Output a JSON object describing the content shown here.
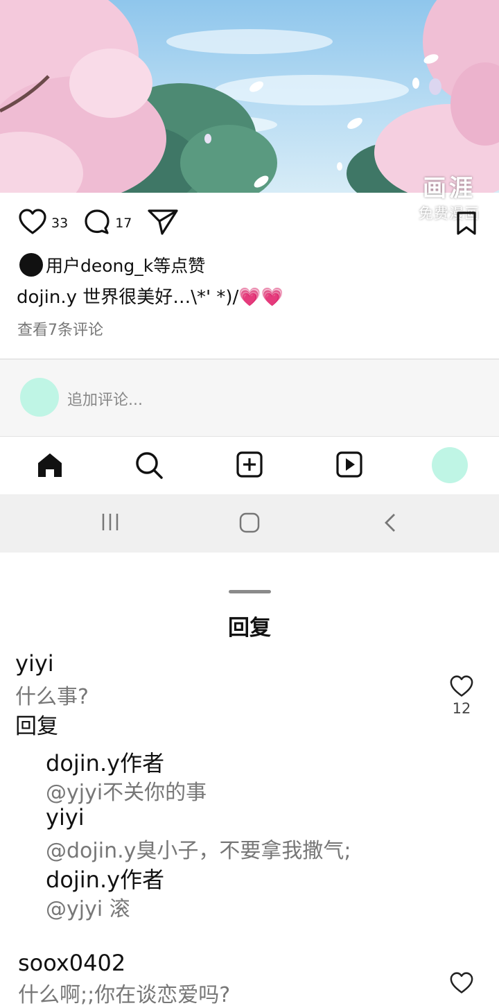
{
  "post": {
    "likes": "33",
    "comments": "17",
    "liked_by": "用户deong_k等点赞",
    "caption": "dojin.y 世界很美好…\\*' *)/",
    "caption_hearts": "💗💗",
    "view_comments": "查看7条评论",
    "watermark_big": "画涯",
    "watermark_small": "免费漫画"
  },
  "comment_input": {
    "placeholder": "追加评论..."
  },
  "tabbar": {
    "icons": [
      "home-icon",
      "search-icon",
      "add-post-icon",
      "reels-icon",
      "profile-avatar"
    ]
  },
  "sheet": {
    "title": "回复",
    "comments": [
      {
        "user": "yiyi",
        "text": "什么事?",
        "reply_label": "回复",
        "likes": "12",
        "replies": [
          {
            "user": "dojin.y作者",
            "text": "@yjyi不关你的事"
          },
          {
            "user": "yiyi",
            "text": "@dojin.y臭小子，不要拿我撒气;"
          },
          {
            "user": "dojin.y作者",
            "text": "@yjyi 滚"
          }
        ]
      },
      {
        "user": "soox0402",
        "text": "什么啊;;你在谈恋爱吗?"
      }
    ]
  },
  "colors": {
    "avatar": "#bff5e5",
    "heart_emoji": "#ff4fa6",
    "muted_text": "#777777"
  }
}
